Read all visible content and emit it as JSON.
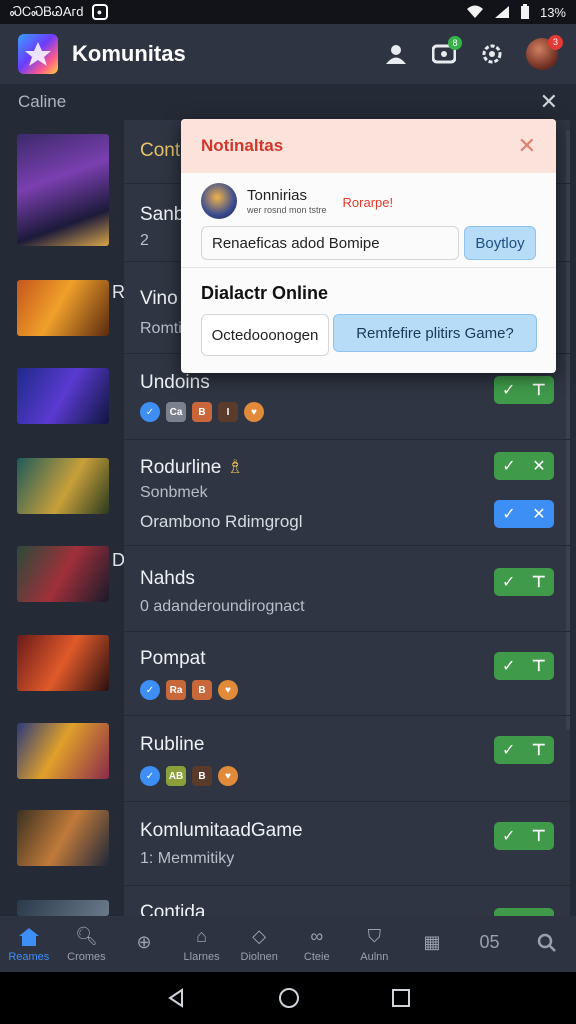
{
  "status_bar": {
    "left_text": "ᏍᏟᏍᏴᏊAᴦd",
    "battery": "13%"
  },
  "app": {
    "title": "Komunitas"
  },
  "app_actions": {
    "notif_badge": "8",
    "avatar_badge": "3"
  },
  "section": {
    "title": "Caline"
  },
  "thumb_side_labels": [
    "",
    "R",
    "",
    "",
    "D",
    "",
    "",
    "",
    ""
  ],
  "rows": [
    {
      "title": "Conta",
      "sub": "Sanb",
      "sub2": "2",
      "chips": []
    },
    {
      "title": "Vino",
      "sub": "Romti",
      "chips": []
    },
    {
      "title": "Undoins",
      "chips": [
        "✓",
        "Ca",
        "B",
        "I",
        "♥"
      ],
      "btn": "green"
    },
    {
      "title": "Rodurline",
      "title_icon": "♗",
      "sub": "Sonbmek",
      "sub2": "Orambono Rdimgrogl",
      "btn": "green",
      "btn2": "blue"
    },
    {
      "title": "Nahds",
      "sub": "0 adanderoundirognact",
      "btn": "green"
    },
    {
      "title": "Pompat",
      "chips": [
        "✓",
        "Ra",
        "B",
        "♥"
      ],
      "btn": "green"
    },
    {
      "title": "Rubline",
      "chips": [
        "✓",
        "AB",
        "B",
        "♥"
      ],
      "btn": "green"
    },
    {
      "title": "KomlumitaadGame",
      "sub": "1: Memmitiky",
      "btn": "green"
    },
    {
      "title": "Contida",
      "btn": "green"
    }
  ],
  "modal": {
    "title": "Notinaltas",
    "user_name": "Tonnirias",
    "user_sub": "wer rosnd mon tstre",
    "user_tag": "Rorarpe!",
    "input_value": "Renaeficas adod Bomipe",
    "input_button": "Boytloy",
    "sub_title": "Dialactr Online",
    "btn_left": "Octedooonogen",
    "btn_right": "Remfefire plitirs Game?"
  },
  "bottom_nav": [
    {
      "label": "Reames",
      "icon": "home-icon",
      "active": true
    },
    {
      "label": "Cromes",
      "icon": "search-icon"
    },
    {
      "label": "",
      "icon": "clock-icon"
    },
    {
      "label": "Llarnes",
      "icon": "house-icon"
    },
    {
      "label": "Diolnen",
      "icon": "diamond-icon"
    },
    {
      "label": "Cteie",
      "icon": "link-icon"
    },
    {
      "label": "Aulnn",
      "icon": "bookmark-icon"
    },
    {
      "label": "",
      "icon": "calendar-icon"
    },
    {
      "label": "",
      "icon": "text-icon",
      "text": "05"
    },
    {
      "label": "",
      "icon": "magnify-icon"
    }
  ],
  "colors": {
    "accent_green": "#3f9a4a",
    "accent_blue": "#3d8ef5",
    "modal_title_red": "#d1372b"
  }
}
